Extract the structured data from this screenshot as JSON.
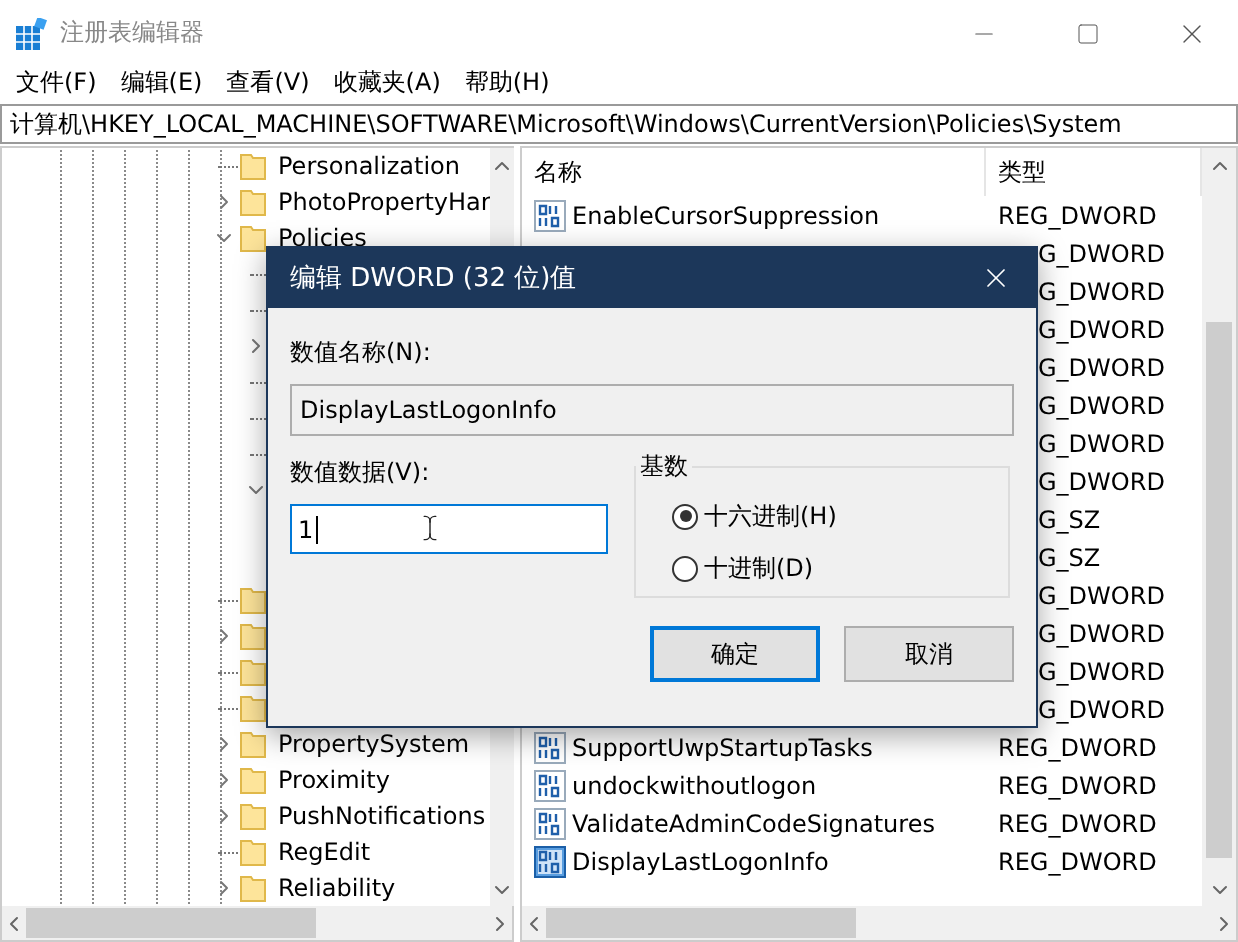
{
  "window": {
    "title": "注册表编辑器"
  },
  "menu": [
    {
      "label": "文件(F)"
    },
    {
      "label": "编辑(E)"
    },
    {
      "label": "查看(V)"
    },
    {
      "label": "收藏夹(A)"
    },
    {
      "label": "帮助(H)"
    }
  ],
  "address": "计算机\\HKEY_LOCAL_MACHINE\\SOFTWARE\\Microsoft\\Windows\\CurrentVersion\\Policies\\System",
  "tree": [
    {
      "kind": "leaf",
      "name": "Personalization"
    },
    {
      "kind": "branch",
      "name": "PhotoPropertyHar",
      "expanded": false
    },
    {
      "kind": "branch",
      "name": "Policies",
      "expanded": true,
      "children": [
        {
          "kind": "leaf"
        },
        {
          "kind": "leaf"
        },
        {
          "kind": "branch",
          "expanded": false
        },
        {
          "kind": "leaf"
        },
        {
          "kind": "leaf"
        },
        {
          "kind": "leaf"
        },
        {
          "kind": "branch",
          "expanded": true
        }
      ]
    },
    {
      "kind": "leaf"
    },
    {
      "kind": "branch",
      "expanded": false
    },
    {
      "kind": "leaf"
    },
    {
      "kind": "leaf"
    },
    {
      "kind": "branch",
      "name": "PropertySystem",
      "expanded": false
    },
    {
      "kind": "branch",
      "name": "Proximity",
      "expanded": false
    },
    {
      "kind": "branch",
      "name": "PushNotifications",
      "expanded": false
    },
    {
      "kind": "leaf",
      "name": "RegEdit"
    },
    {
      "kind": "branch",
      "name": "Reliability",
      "expanded": false
    }
  ],
  "values": {
    "columns": [
      "名称",
      "类型"
    ],
    "rows": [
      {
        "name": "EnableCursorSuppression",
        "type": "REG_DWORD",
        "selected": false
      },
      {
        "type": "G_DWORD"
      },
      {
        "type": "G_DWORD"
      },
      {
        "type": "G_DWORD"
      },
      {
        "type": "G_DWORD"
      },
      {
        "type": "G_DWORD"
      },
      {
        "type": "G_DWORD"
      },
      {
        "type": "G_DWORD"
      },
      {
        "type": "G_SZ"
      },
      {
        "type": "G_SZ"
      },
      {
        "type": "G_DWORD"
      },
      {
        "type": "G_DWORD"
      },
      {
        "type": "G_DWORD"
      },
      {
        "type": "G_DWORD"
      },
      {
        "name": "SupportUwpStartupTasks",
        "type": "REG_DWORD",
        "selected": false
      },
      {
        "name": "undockwithoutlogon",
        "type": "REG_DWORD",
        "selected": false
      },
      {
        "name": "ValidateAdminCodeSignatures",
        "type": "REG_DWORD",
        "selected": false
      },
      {
        "name": "DisplayLastLogonInfo",
        "type": "REG_DWORD",
        "selected": true
      }
    ]
  },
  "dialog": {
    "title": "编辑 DWORD (32 位)值",
    "name_label": "数值名称(N):",
    "name_value": "DisplayLastLogonInfo",
    "data_label": "数值数据(V):",
    "data_value": "1",
    "base": {
      "legend": "基数",
      "options": [
        {
          "label": "十六进制(H)",
          "selected": true
        },
        {
          "label": "十进制(D)",
          "selected": false
        }
      ]
    },
    "buttons": [
      {
        "label": "确定",
        "default": true
      },
      {
        "label": "取消",
        "default": false
      }
    ]
  }
}
